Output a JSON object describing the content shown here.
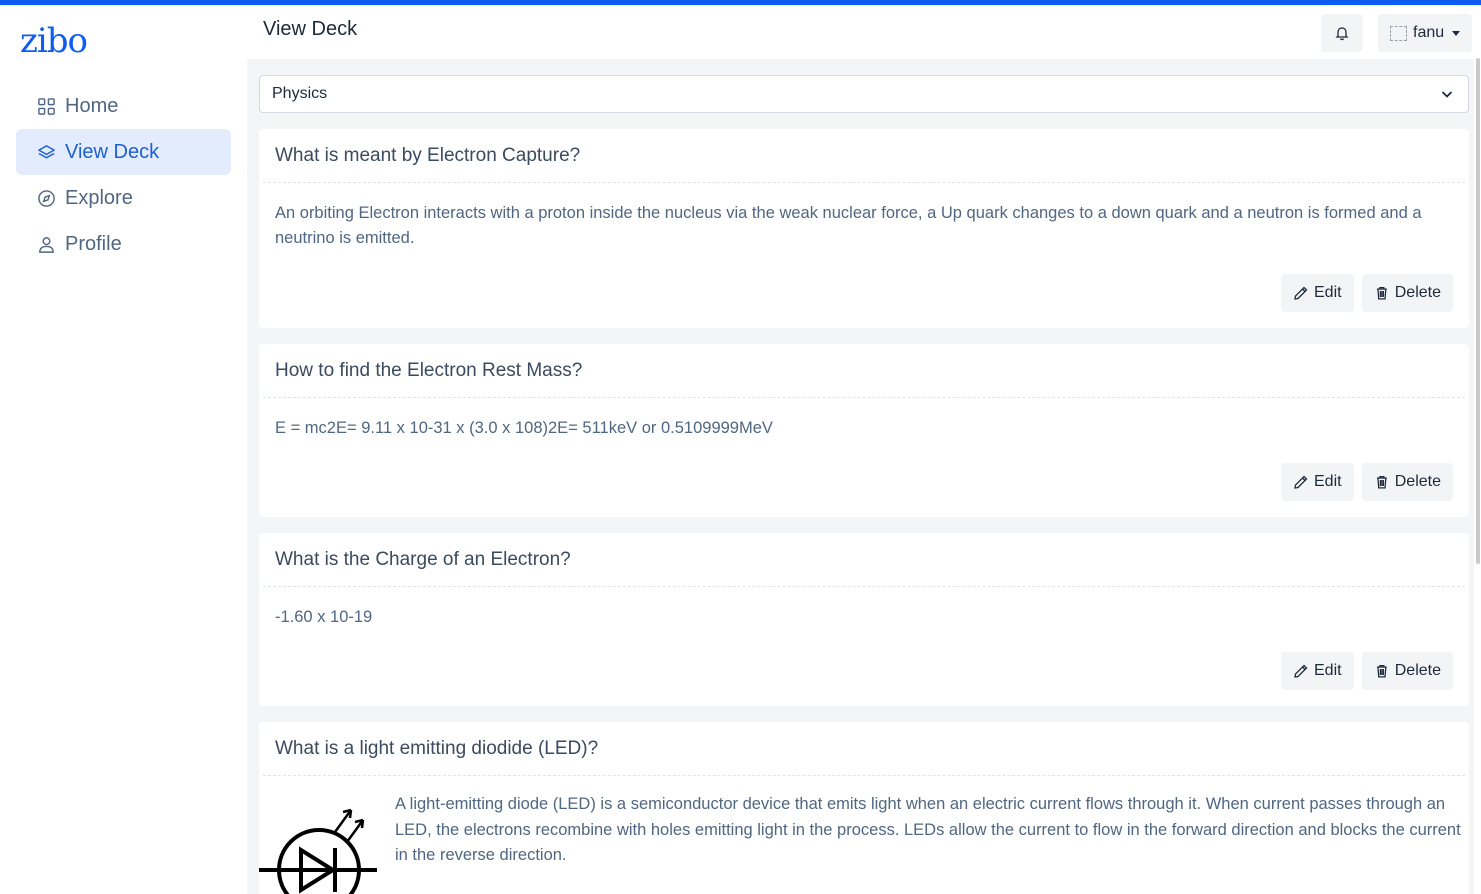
{
  "app": {
    "logo": "zibo"
  },
  "sidebar": {
    "items": [
      {
        "label": "Home",
        "icon": "grid-icon",
        "active": false
      },
      {
        "label": "View Deck",
        "icon": "layers-icon",
        "active": true
      },
      {
        "label": "Explore",
        "icon": "compass-icon",
        "active": false
      },
      {
        "label": "Profile",
        "icon": "user-icon",
        "active": false
      }
    ]
  },
  "header": {
    "title": "View Deck",
    "user_name": "fanu"
  },
  "deck_select": {
    "value": "Physics"
  },
  "cards": [
    {
      "question": "What is meant by Electron Capture?",
      "answer": "An orbiting Electron interacts with a proton inside the nucleus via the weak nuclear force, a Up quark changes to a down quark and a neutron is formed and a neutrino is emitted."
    },
    {
      "question": "How to find the Electron Rest Mass?",
      "answer": "E = mc2E= 9.11 x 10-31 x (3.0 x 108)2E= 511keV or 0.5109999MeV"
    },
    {
      "question": "What is the Charge of an Electron?",
      "answer": "-1.60 x 10-19"
    },
    {
      "question": "What is a light emitting diodide (LED)?",
      "answer": "A light-emitting diode (LED) is a semiconductor device that emits light when an electric current flows through it. When current passes through an LED, the electrons recombine with holes emitting light in the process. LEDs allow the current to flow in the forward direction and blocks the current in the reverse direction."
    }
  ],
  "actions": {
    "edit_label": "Edit",
    "delete_label": "Delete"
  },
  "colors": {
    "accent": "#0d5df2",
    "active_bg": "#e3ecfd",
    "main_bg": "#f4f5f7"
  }
}
